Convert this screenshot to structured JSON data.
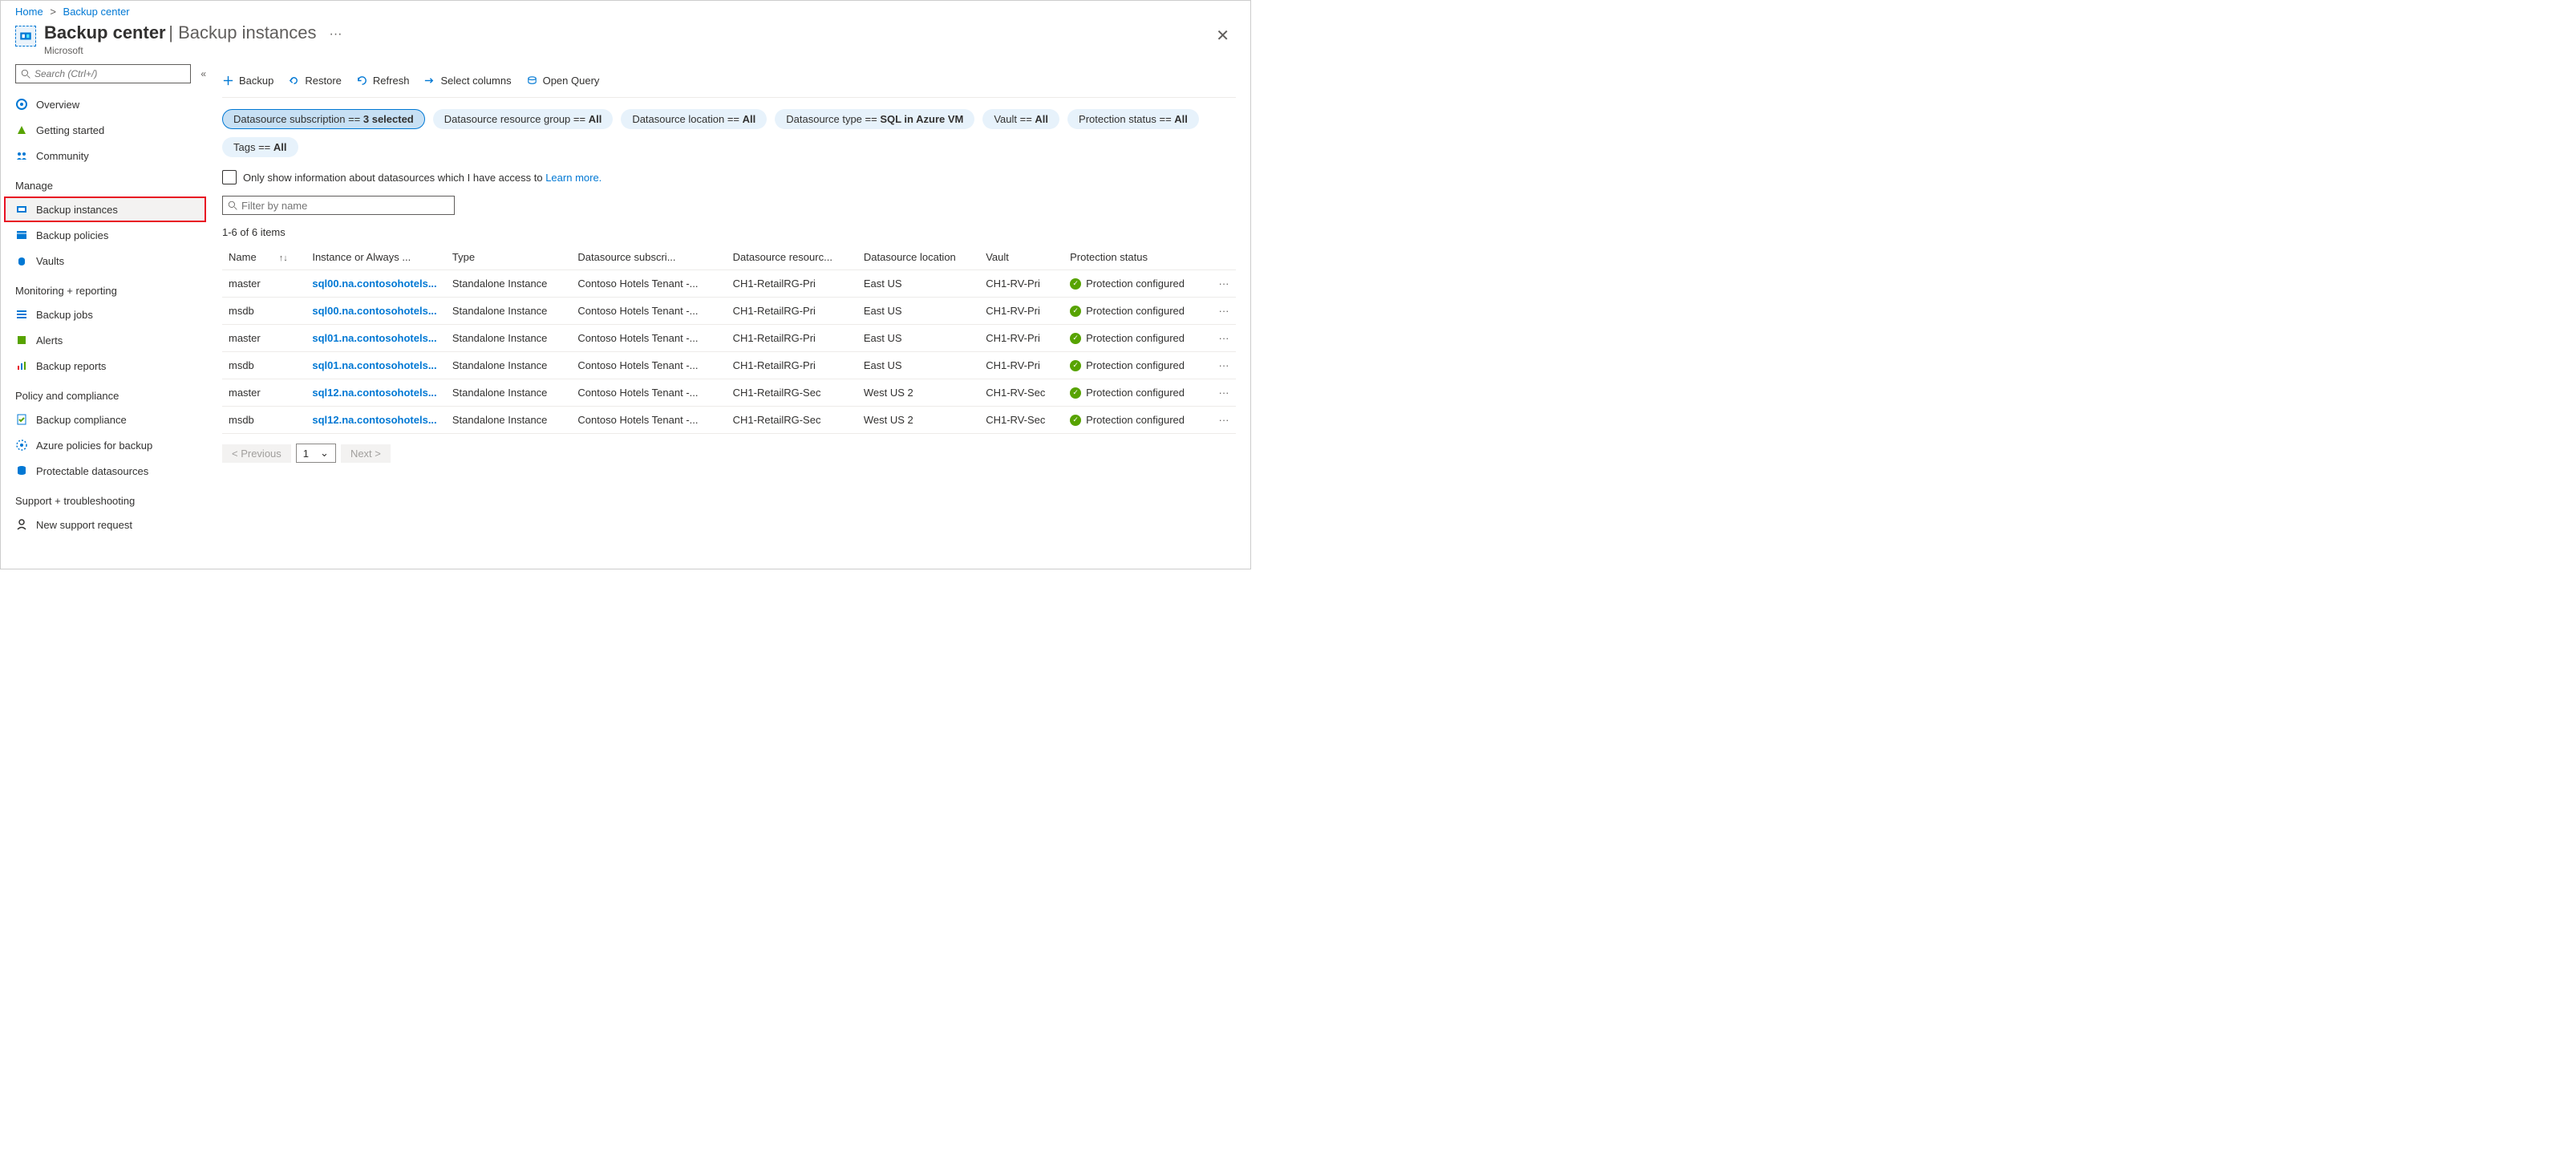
{
  "breadcrumb": {
    "home": "Home",
    "current": "Backup center"
  },
  "header": {
    "title": "Backup center",
    "subtitle": "Backup instances",
    "org": "Microsoft"
  },
  "sidebar": {
    "search_placeholder": "Search (Ctrl+/)",
    "top": [
      {
        "label": "Overview"
      },
      {
        "label": "Getting started"
      },
      {
        "label": "Community"
      }
    ],
    "groups": [
      {
        "title": "Manage",
        "items": [
          {
            "label": "Backup instances",
            "selected": true,
            "highlight": true
          },
          {
            "label": "Backup policies"
          },
          {
            "label": "Vaults"
          }
        ]
      },
      {
        "title": "Monitoring + reporting",
        "items": [
          {
            "label": "Backup jobs"
          },
          {
            "label": "Alerts"
          },
          {
            "label": "Backup reports"
          }
        ]
      },
      {
        "title": "Policy and compliance",
        "items": [
          {
            "label": "Backup compliance"
          },
          {
            "label": "Azure policies for backup"
          },
          {
            "label": "Protectable datasources"
          }
        ]
      },
      {
        "title": "Support + troubleshooting",
        "items": [
          {
            "label": "New support request"
          }
        ]
      }
    ]
  },
  "toolbar": {
    "backup": "Backup",
    "restore": "Restore",
    "refresh": "Refresh",
    "select_columns": "Select columns",
    "open_query": "Open Query"
  },
  "filters": {
    "subscription": {
      "label": "Datasource subscription == ",
      "value": "3 selected"
    },
    "resource_group": {
      "label": "Datasource resource group == ",
      "value": "All"
    },
    "location": {
      "label": "Datasource location == ",
      "value": "All"
    },
    "type": {
      "label": "Datasource type == ",
      "value": "SQL in Azure VM"
    },
    "vault": {
      "label": "Vault == ",
      "value": "All"
    },
    "protection": {
      "label": "Protection status == ",
      "value": "All"
    },
    "tags": {
      "label": "Tags == ",
      "value": "All"
    }
  },
  "access_row": {
    "text": "Only show information about datasources which I have access to ",
    "link": "Learn more."
  },
  "filter_placeholder": "Filter by name",
  "count_text": "1-6 of 6 items",
  "columns": {
    "name": "Name",
    "instance": "Instance or Always ...",
    "type": "Type",
    "subscription": "Datasource subscri...",
    "resource": "Datasource resourc...",
    "location": "Datasource location",
    "vault": "Vault",
    "status": "Protection status"
  },
  "rows": [
    {
      "name": "master",
      "instance": "sql00.na.contosohotels...",
      "type": "Standalone Instance",
      "subscription": "Contoso Hotels Tenant -...",
      "resource": "CH1-RetailRG-Pri",
      "location": "East US",
      "vault": "CH1-RV-Pri",
      "status": "Protection configured"
    },
    {
      "name": "msdb",
      "instance": "sql00.na.contosohotels...",
      "type": "Standalone Instance",
      "subscription": "Contoso Hotels Tenant -...",
      "resource": "CH1-RetailRG-Pri",
      "location": "East US",
      "vault": "CH1-RV-Pri",
      "status": "Protection configured"
    },
    {
      "name": "master",
      "instance": "sql01.na.contosohotels...",
      "type": "Standalone Instance",
      "subscription": "Contoso Hotels Tenant -...",
      "resource": "CH1-RetailRG-Pri",
      "location": "East US",
      "vault": "CH1-RV-Pri",
      "status": "Protection configured"
    },
    {
      "name": "msdb",
      "instance": "sql01.na.contosohotels...",
      "type": "Standalone Instance",
      "subscription": "Contoso Hotels Tenant -...",
      "resource": "CH1-RetailRG-Pri",
      "location": "East US",
      "vault": "CH1-RV-Pri",
      "status": "Protection configured"
    },
    {
      "name": "master",
      "instance": "sql12.na.contosohotels...",
      "type": "Standalone Instance",
      "subscription": "Contoso Hotels Tenant -...",
      "resource": "CH1-RetailRG-Sec",
      "location": "West US 2",
      "vault": "CH1-RV-Sec",
      "status": "Protection configured"
    },
    {
      "name": "msdb",
      "instance": "sql12.na.contosohotels...",
      "type": "Standalone Instance",
      "subscription": "Contoso Hotels Tenant -...",
      "resource": "CH1-RetailRG-Sec",
      "location": "West US 2",
      "vault": "CH1-RV-Sec",
      "status": "Protection configured"
    }
  ],
  "pager": {
    "prev": "< Previous",
    "page": "1",
    "next": "Next >"
  }
}
